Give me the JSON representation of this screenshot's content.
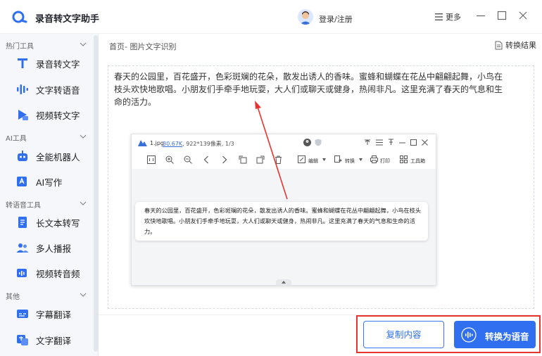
{
  "app": {
    "title": "录音转文字助手"
  },
  "header": {
    "login": "登录/注册",
    "more": "更多"
  },
  "sidebar": {
    "sections": [
      {
        "title": "热门工具",
        "items": [
          "录音转文字",
          "文字转语音",
          "视频转文字"
        ]
      },
      {
        "title": "AI工具",
        "items": [
          "全能机器人",
          "AI写作"
        ]
      },
      {
        "title": "转语音工具",
        "items": [
          "长文本转写",
          "多人播报",
          "视频转音频"
        ]
      },
      {
        "title": "其他",
        "items": [
          "字幕翻译",
          "文字翻译"
        ]
      }
    ]
  },
  "main": {
    "breadcrumb": "首页- 图片文字识别",
    "result_link": "转换结果",
    "editor_text": "春天的公园里，百花盛开，色彩斑斓的花朵，散发出诱人的香味。蜜蜂和蝴蝶在花丛中翩翩起舞，小鸟在枝头欢快地歌唱。小朋友们手牵手地玩耍，大人们或聊天或健身，热闹非凡。这里充满了春天的气息和生命的活力。"
  },
  "viewer": {
    "filename": "1.jpg",
    "filesize": "30.67K",
    "dims": ", 922*139像素",
    "page": ", 1/3",
    "tools": {
      "edit": "编辑",
      "convert": "转换",
      "print": "打印",
      "toolbox": "工具箱"
    },
    "ocr_text": "春天的公园里，百花盛开，色彩斑斓的花朵，散发出诱人的香味。蜜蜂和蝴蝶在花丛中翩翩起舞，小鸟在枝头欢快地歌唱。小朋友们手牵手地玩耍，大人们或聊天或健身，热闹非凡。这里充满了春天的气息和生命的活力。"
  },
  "actions": {
    "copy": "复制内容",
    "convert": "转换为语音"
  },
  "colors": {
    "accent": "#2f6ff0",
    "highlight": "#e8332f"
  }
}
